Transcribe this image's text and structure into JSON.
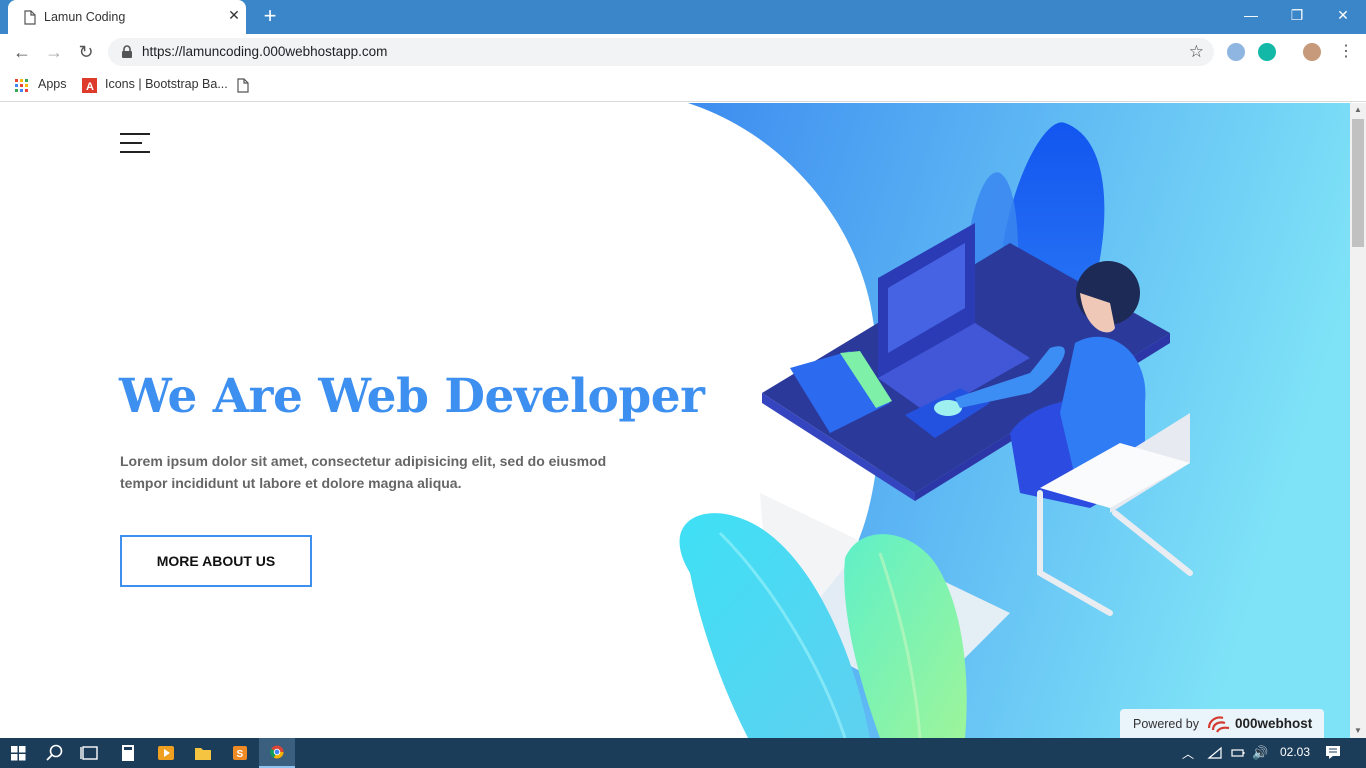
{
  "browser": {
    "tab_title": "Lamun Coding",
    "new_tab_label": "+",
    "url": "https://lamuncoding.000webhostapp.com",
    "bookmarks": [
      {
        "label": "Apps",
        "icon": "apps-grid-icon"
      },
      {
        "label": "Icons | Bootstrap Ba...",
        "icon": "angular-icon"
      },
      {
        "label": "",
        "icon": "page-icon"
      }
    ]
  },
  "hero": {
    "title": "We Are Web Developer",
    "text": "Lorem ipsum dolor sit amet, consectetur adipisicing elit, sed do eiusmod tempor incididunt ut labore et dolore magna aliqua.",
    "button_label": "MORE ABOUT US"
  },
  "powered": {
    "label": "Powered by",
    "brand": "000webhost"
  },
  "taskbar": {
    "clock": "02.03"
  },
  "colors": {
    "accent": "#3d8ff0",
    "titlebar": "#3a86c8",
    "taskbar": "#1c3d5a"
  }
}
